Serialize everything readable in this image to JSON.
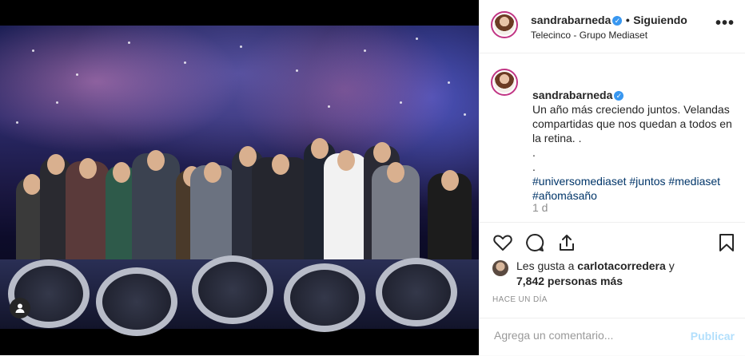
{
  "post": {
    "photo_alt_icon": "user-tag-icon"
  },
  "header": {
    "username": "sandrabarneda",
    "verified_icon": "verified-badge-icon",
    "separator": "•",
    "follow_status": "Siguiendo",
    "location": "Telecinco - Grupo Mediaset",
    "more_icon": "more-options-icon",
    "more_label": "•••"
  },
  "caption": {
    "username": "sandrabarneda",
    "text": "Un año más creciendo juntos. Velandas compartidas que nos quedan a todos en la retina. .\n.\n.",
    "hashtags": "#universomediaset #juntos #mediaset #añomásaño",
    "time": "1 d"
  },
  "actions": {
    "like_icon": "heart-icon",
    "comment_icon": "comment-icon",
    "share_icon": "share-icon",
    "save_icon": "bookmark-icon"
  },
  "likes": {
    "prefix": "Les gusta a",
    "user": "carlotacorredera",
    "conjunction": "y",
    "count_text": "7,842 personas más"
  },
  "posted_ago": "HACE UN DÍA",
  "comment": {
    "placeholder": "Agrega un comentario...",
    "publish_label": "Publicar"
  },
  "colors": {
    "link": "#003569",
    "publish_disabled": "#b2dffc",
    "verified": "#3897f0",
    "secondary_text": "#8e8e8e"
  }
}
